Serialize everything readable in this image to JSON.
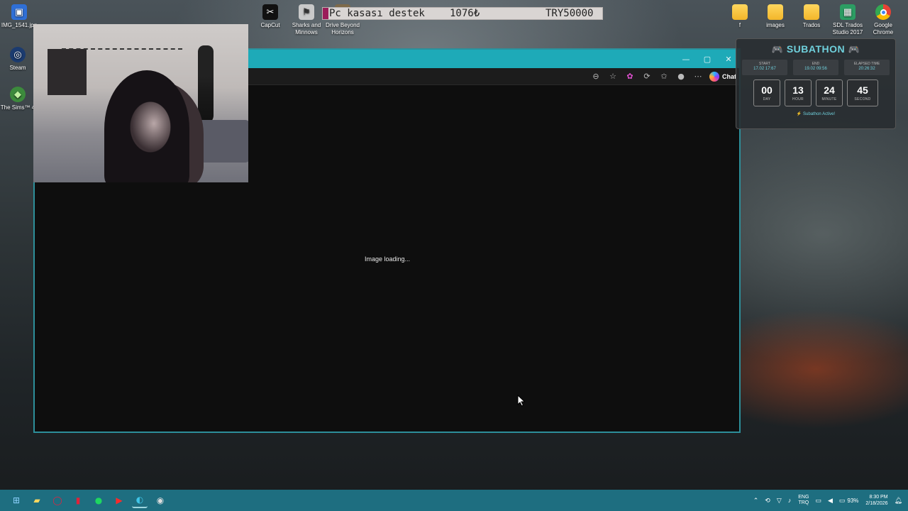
{
  "desktop_icons": [
    {
      "id": "img1541",
      "label": "IMG_1541.jpg",
      "icon": "image-file-icon"
    },
    {
      "id": "steam",
      "label": "Steam",
      "icon": "steam-icon"
    },
    {
      "id": "sims",
      "label": "The Sims™ 4",
      "icon": "sims-icon"
    },
    {
      "id": "capcut",
      "label": "CapCut",
      "icon": "capcut-icon"
    },
    {
      "id": "sharks",
      "label": "Sharks and Minnows",
      "icon": "game-icon"
    },
    {
      "id": "drive",
      "label": "Drive Beyond Horizons",
      "icon": "game-icon"
    },
    {
      "id": "f",
      "label": "f",
      "icon": "folder-icon"
    },
    {
      "id": "images",
      "label": "images",
      "icon": "folder-icon"
    },
    {
      "id": "trados",
      "label": "Trados",
      "icon": "folder-icon"
    },
    {
      "id": "sdl",
      "label": "SDL Trados Studio 2017",
      "icon": "sdl-trados-icon"
    },
    {
      "id": "chrome",
      "label": "Google Chrome",
      "icon": "chrome-icon"
    }
  ],
  "donation_bar": {
    "goal_text": "Pc kasası destek",
    "current": "1076₺",
    "goal": "TRY50000"
  },
  "browser": {
    "loading_text": "Image loading...",
    "chat_label": "Chat"
  },
  "subathon": {
    "title": "SUBATHON",
    "start_label": "START",
    "start_value": "17.02 17:67",
    "end_label": "END",
    "end_value": "19.02 09:56",
    "elapsed_label": "ELAPSED TIME",
    "elapsed_value": "20:26:32",
    "days": "00",
    "days_label": "DAY",
    "hours": "13",
    "hours_label": "HOUR",
    "minutes": "24",
    "minutes_label": "MINUTE",
    "seconds": "45",
    "seconds_label": "SECOND",
    "status": "Subathon Active!"
  },
  "taskbar": {
    "lang_top": "ENG",
    "lang_bottom": "TRQ",
    "battery": "93%",
    "time": "8:30 PM",
    "date": "2/18/2026"
  },
  "colors": {
    "taskbar": "#1e6e80",
    "titlebar": "#1eaab8",
    "accent": "#6fd0dc"
  }
}
